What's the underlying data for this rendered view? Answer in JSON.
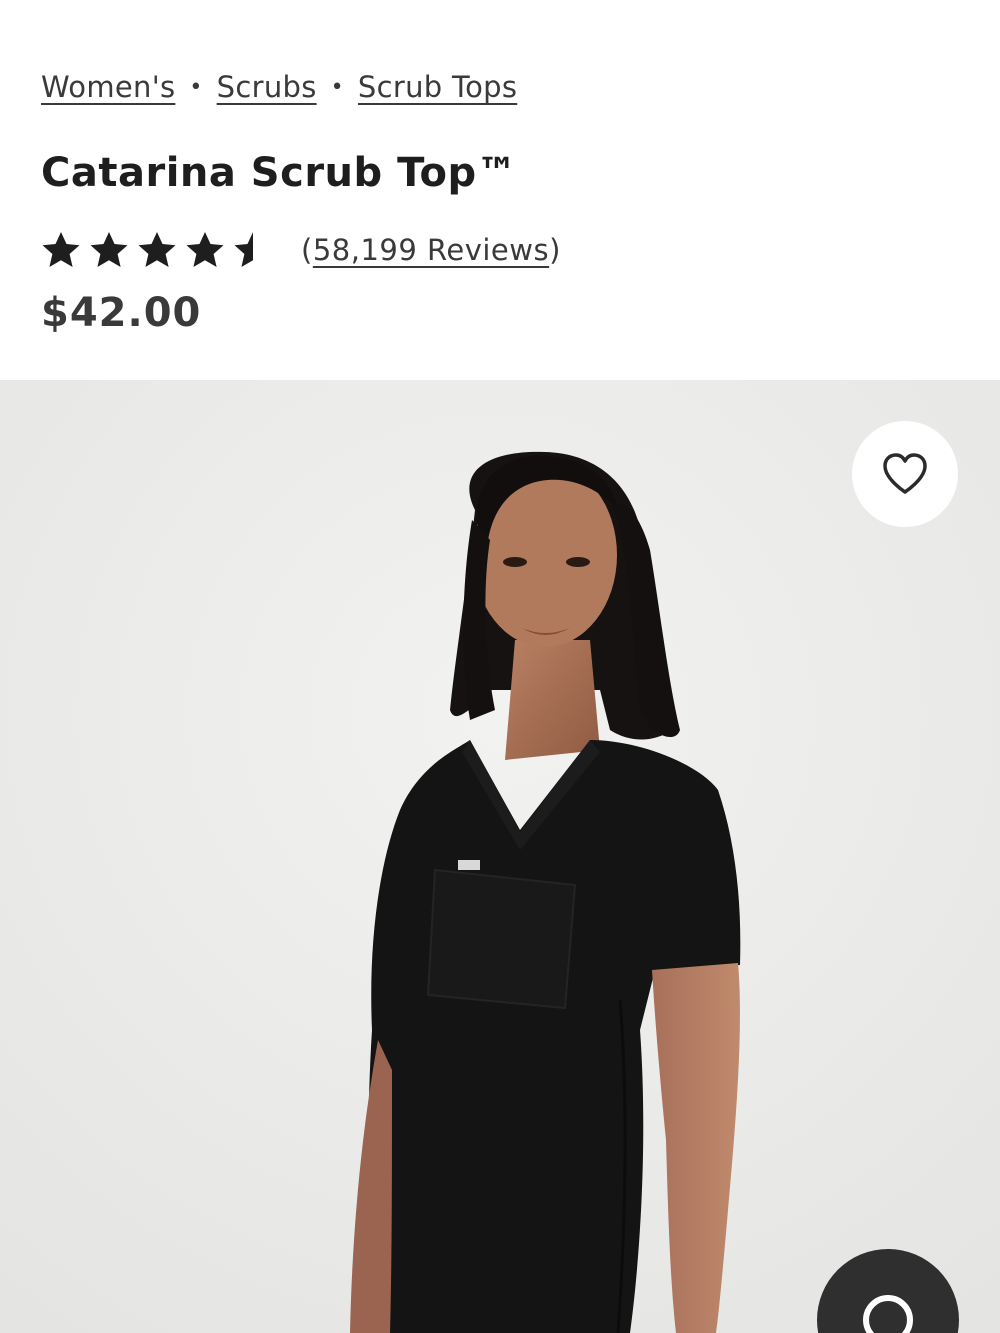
{
  "breadcrumb": {
    "items": [
      "Women's",
      "Scrubs",
      "Scrub Tops"
    ],
    "separator": "•"
  },
  "product": {
    "title": "Catarina Scrub Top™",
    "rating": 4.5,
    "reviews_open": "(",
    "reviews_label": "58,199 Reviews",
    "reviews_close": ")",
    "price": "$42.00"
  },
  "hero": {
    "background_color": "#ececea",
    "garment_color": "#141414"
  },
  "icons": {
    "favorite": "heart-icon",
    "chat": "chat-bubble-icon",
    "star": "star-icon"
  }
}
